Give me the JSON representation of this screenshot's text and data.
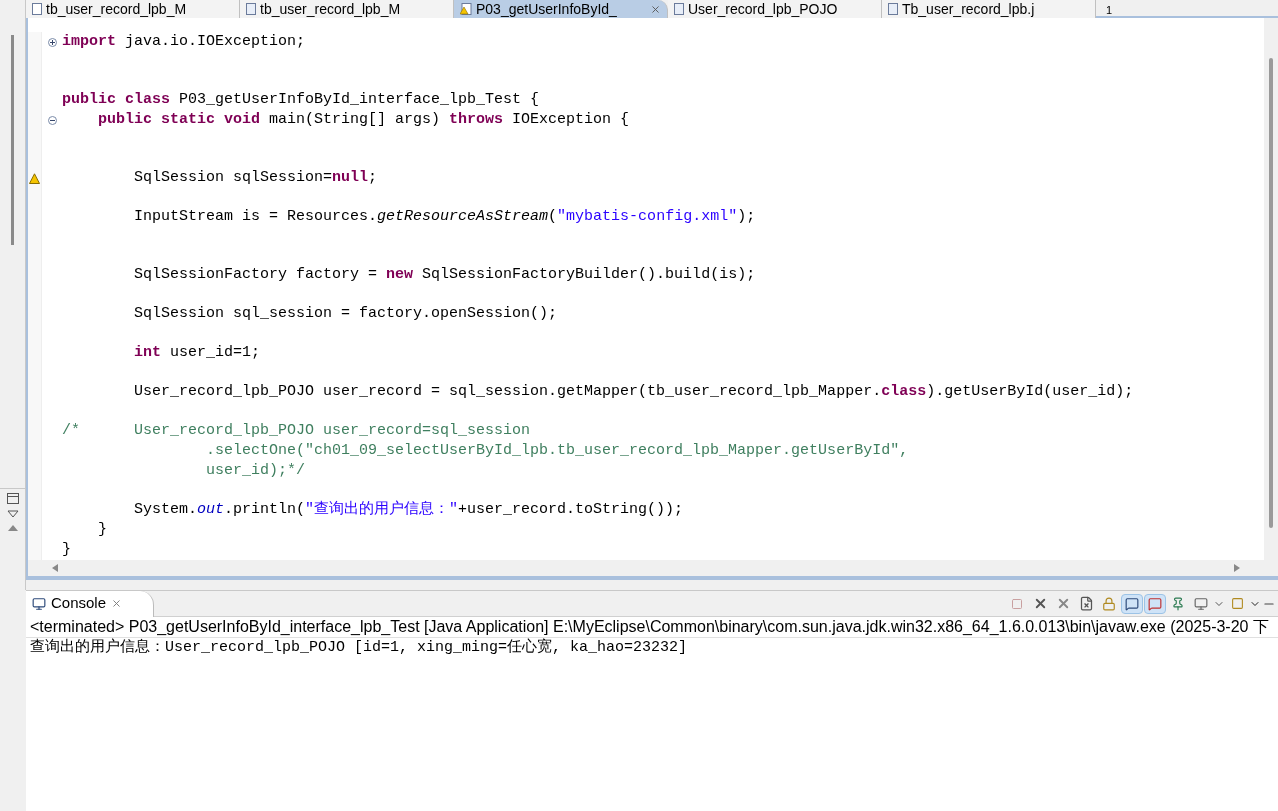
{
  "editor_tabs": [
    {
      "label": "tb_user_record_lpb_M",
      "kind": "xml",
      "selected": false
    },
    {
      "label": "tb_user_record_lpb_M",
      "kind": "java",
      "selected": false
    },
    {
      "label": "P03_getUserInfoById_",
      "kind": "warn",
      "selected": true
    },
    {
      "label": "User_record_lpb_POJO",
      "kind": "java",
      "selected": false
    },
    {
      "label": "Tb_user_record_lpb.j",
      "kind": "java",
      "selected": false
    }
  ],
  "tab_overflow": "1",
  "code_lines": [
    {
      "kind": "code",
      "fold": {
        "expanded": false
      },
      "tokens": [
        {
          "kind": "kw",
          "t": "import"
        },
        {
          "kind": "p",
          "t": " java.io.IOException;"
        }
      ]
    },
    {
      "kind": "blank"
    },
    {
      "kind": "blank"
    },
    {
      "kind": "code",
      "tokens": [
        {
          "kind": "kw",
          "t": "public class"
        },
        {
          "kind": "p",
          "t": " P03_getUserInfoById_interface_lpb_Test {"
        }
      ]
    },
    {
      "kind": "code",
      "fold": {
        "expanded": true
      },
      "tokens": [
        {
          "kind": "kw",
          "t": "    public static void"
        },
        {
          "kind": "p",
          "t": " main(String[] args) "
        },
        {
          "kind": "kw",
          "t": "throws"
        },
        {
          "kind": "p",
          "t": " IOException {"
        }
      ]
    },
    {
      "kind": "blank"
    },
    {
      "kind": "blank"
    },
    {
      "kind": "code",
      "warning": true,
      "tokens": [
        {
          "kind": "p",
          "t": "        SqlSession sqlSession="
        },
        {
          "kind": "kw",
          "t": "null"
        },
        {
          "kind": "p",
          "t": ";"
        }
      ]
    },
    {
      "kind": "blank"
    },
    {
      "kind": "code",
      "tokens": [
        {
          "kind": "p",
          "t": "        InputStream is = Resources."
        },
        {
          "kind": "it",
          "t": "getResourceAsStream"
        },
        {
          "kind": "p",
          "t": "("
        },
        {
          "kind": "str",
          "t": "\"mybatis-config.xml\""
        },
        {
          "kind": "p",
          "t": ");"
        }
      ]
    },
    {
      "kind": "blank"
    },
    {
      "kind": "blank"
    },
    {
      "kind": "code",
      "tokens": [
        {
          "kind": "p",
          "t": "        SqlSessionFactory factory = "
        },
        {
          "kind": "kw",
          "t": "new"
        },
        {
          "kind": "p",
          "t": " SqlSessionFactoryBuilder().build(is);"
        }
      ]
    },
    {
      "kind": "blank"
    },
    {
      "kind": "code",
      "tokens": [
        {
          "kind": "p",
          "t": "        SqlSession sql_session = factory.openSession();"
        }
      ]
    },
    {
      "kind": "blank"
    },
    {
      "kind": "code",
      "tokens": [
        {
          "kind": "kw",
          "t": "        int"
        },
        {
          "kind": "p",
          "t": " user_id=1;"
        }
      ]
    },
    {
      "kind": "blank"
    },
    {
      "kind": "code",
      "tokens": [
        {
          "kind": "p",
          "t": "        User_record_lpb_POJO user_record = sql_session.getMapper(tb_user_record_lpb_Mapper."
        },
        {
          "kind": "kw",
          "t": "class"
        },
        {
          "kind": "p",
          "t": ").getUserById(user_id);"
        }
      ]
    },
    {
      "kind": "blank"
    },
    {
      "kind": "code",
      "tokens": [
        {
          "kind": "cm",
          "t": "/*      User_record_lpb_POJO user_record=sql_session"
        }
      ]
    },
    {
      "kind": "code",
      "tokens": [
        {
          "kind": "cm",
          "t": "                .selectOne(\"ch01_09_selectUserById_lpb.tb_user_record_lpb_Mapper.getUserById\","
        }
      ]
    },
    {
      "kind": "code",
      "tokens": [
        {
          "kind": "cm",
          "t": "                user_id);*/"
        }
      ]
    },
    {
      "kind": "blank"
    },
    {
      "kind": "code",
      "tokens": [
        {
          "kind": "p",
          "t": "        System."
        },
        {
          "kind": "itb",
          "t": "out"
        },
        {
          "kind": "p",
          "t": ".println("
        },
        {
          "kind": "str",
          "t": "\"查询出的用户信息：\""
        },
        {
          "kind": "p",
          "t": "+user_record.toString());"
        }
      ]
    },
    {
      "kind": "code",
      "tokens": [
        {
          "kind": "p",
          "t": "    }"
        }
      ]
    },
    {
      "kind": "code",
      "tokens": [
        {
          "kind": "p",
          "t": "}"
        }
      ]
    }
  ],
  "console": {
    "title": "Console",
    "status": "<terminated> P03_getUserInfoById_interface_lpb_Test [Java Application] E:\\MyEclipse\\Common\\binary\\com.sun.java.jdk.win32.x86_64_1.6.0.013\\bin\\javaw.exe (2025-3-20 下",
    "output": "查询出的用户信息：User_record_lpb_POJO [id=1, xing_ming=任心宽, ka_hao=23232]"
  }
}
